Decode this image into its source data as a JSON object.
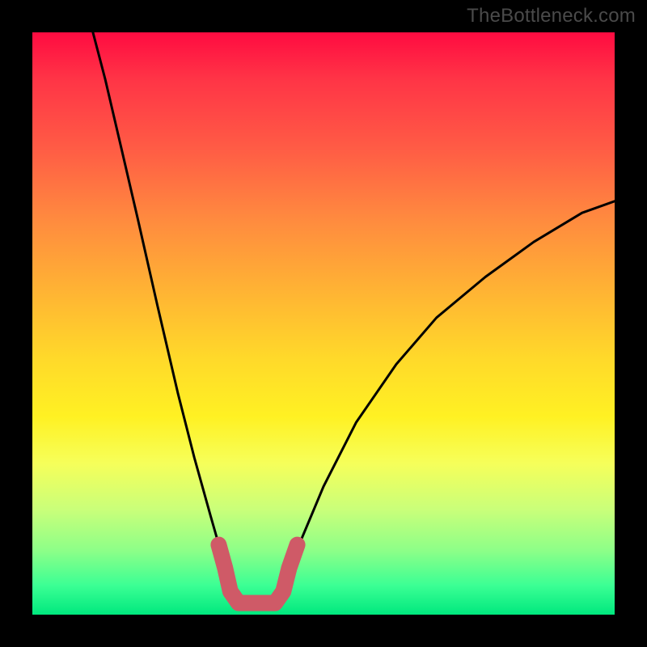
{
  "watermark": "TheBottleneck.com",
  "chart_data": {
    "type": "line",
    "title": "",
    "xlabel": "",
    "ylabel": "",
    "xlim": [
      0,
      100
    ],
    "ylim": [
      0,
      100
    ],
    "curve": {
      "name": "bottleneck-curve",
      "color": "#000000",
      "points": [
        {
          "x": 10.4,
          "y": 100
        },
        {
          "x": 12.5,
          "y": 92
        },
        {
          "x": 15.3,
          "y": 80
        },
        {
          "x": 18.1,
          "y": 68
        },
        {
          "x": 21.5,
          "y": 53
        },
        {
          "x": 25.0,
          "y": 38
        },
        {
          "x": 27.8,
          "y": 27
        },
        {
          "x": 30.6,
          "y": 17
        },
        {
          "x": 32.6,
          "y": 10
        },
        {
          "x": 34.0,
          "y": 5
        },
        {
          "x": 36.1,
          "y": 2
        },
        {
          "x": 38.9,
          "y": 2
        },
        {
          "x": 41.7,
          "y": 2
        },
        {
          "x": 43.1,
          "y": 4
        },
        {
          "x": 44.4,
          "y": 8
        },
        {
          "x": 45.8,
          "y": 12
        },
        {
          "x": 50.0,
          "y": 22
        },
        {
          "x": 55.6,
          "y": 33
        },
        {
          "x": 62.5,
          "y": 43
        },
        {
          "x": 69.4,
          "y": 51
        },
        {
          "x": 77.8,
          "y": 58
        },
        {
          "x": 86.1,
          "y": 64
        },
        {
          "x": 94.4,
          "y": 69
        },
        {
          "x": 100,
          "y": 71
        }
      ]
    },
    "highlight": {
      "name": "optimal-range-marker",
      "color": "#cf5a67",
      "points": [
        {
          "x": 32.0,
          "y": 12
        },
        {
          "x": 33.1,
          "y": 8
        },
        {
          "x": 34.0,
          "y": 4
        },
        {
          "x": 35.4,
          "y": 2
        },
        {
          "x": 37.5,
          "y": 2
        },
        {
          "x": 39.6,
          "y": 2
        },
        {
          "x": 41.7,
          "y": 2
        },
        {
          "x": 43.1,
          "y": 4
        },
        {
          "x": 44.1,
          "y": 8
        },
        {
          "x": 45.5,
          "y": 12
        }
      ]
    }
  }
}
